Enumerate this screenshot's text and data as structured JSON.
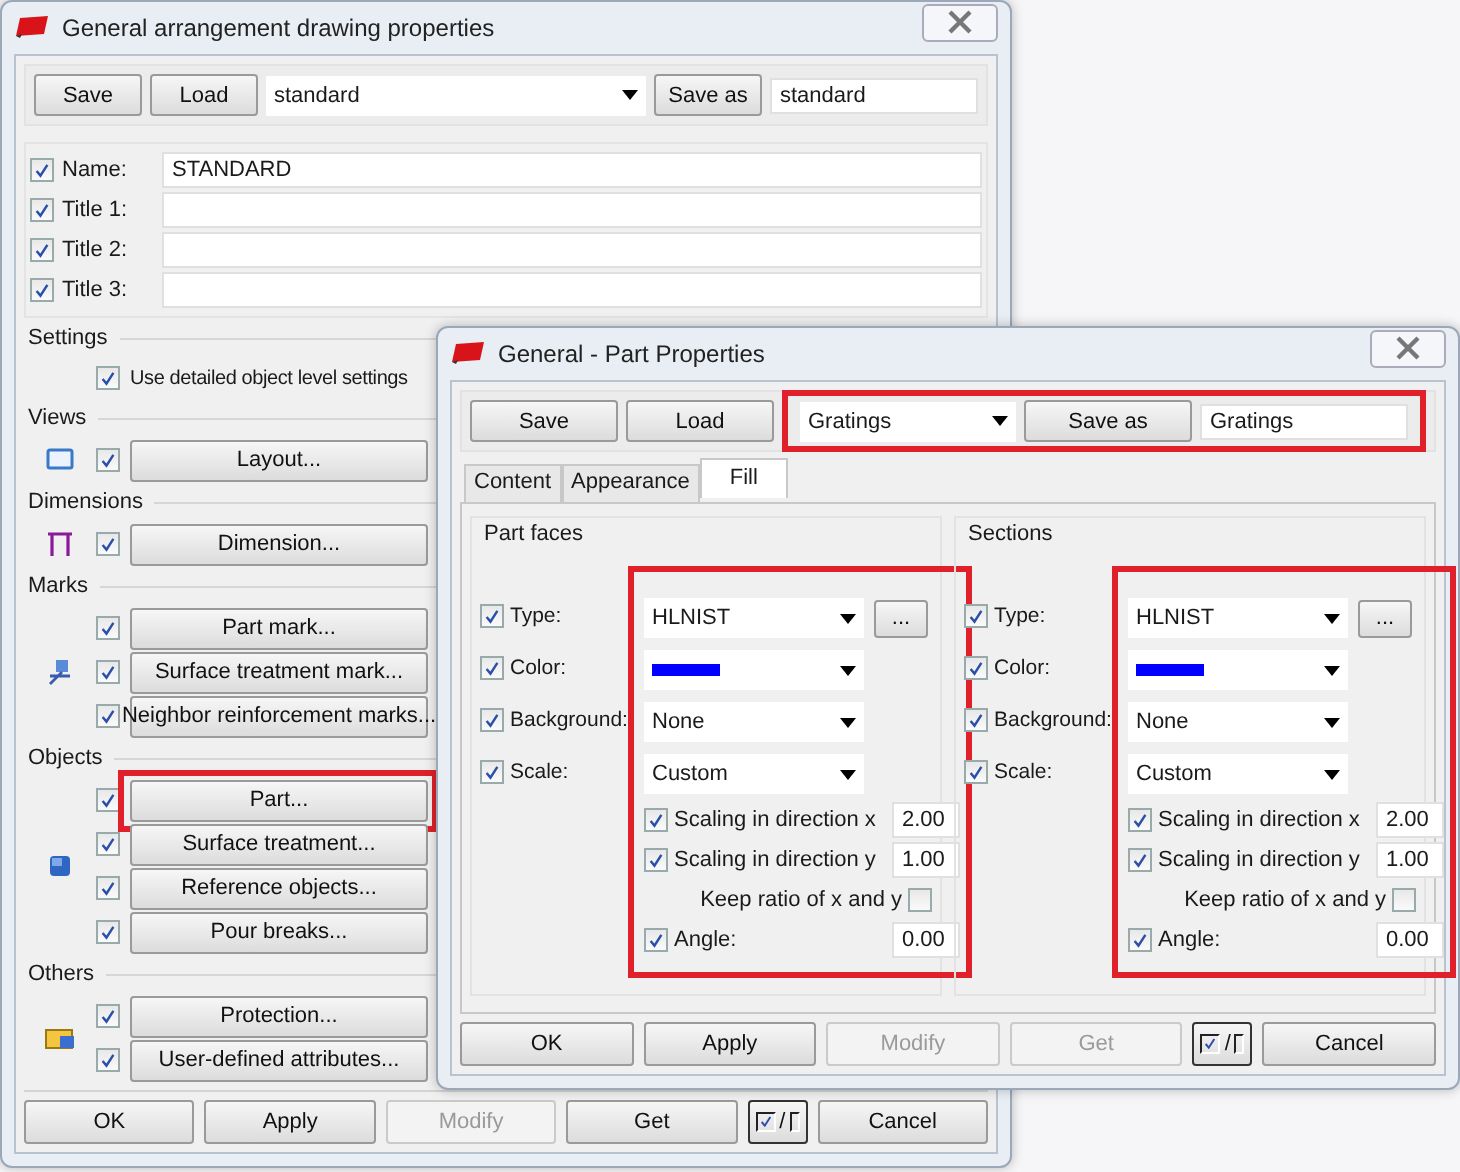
{
  "main_window": {
    "title": "General arrangement drawing properties",
    "file_bar": {
      "save": "Save",
      "load": "Load",
      "preset": "standard",
      "save_as": "Save as",
      "name": "standard"
    },
    "name_fields": [
      {
        "label": "Name:",
        "checked": true,
        "value": "STANDARD"
      },
      {
        "label": "Title 1:",
        "checked": true
      },
      {
        "label": "Title 2:",
        "checked": true
      },
      {
        "label": "Title 3:",
        "checked": true
      }
    ],
    "sections": [
      {
        "title": "Settings",
        "items": [
          {
            "kind": "checkbox",
            "label": "Use detailed object level settings",
            "checked": true
          }
        ]
      },
      {
        "title": "Views",
        "items": [
          {
            "kind": "button",
            "label": "Layout...",
            "checked": true,
            "highlighted": false
          }
        ]
      },
      {
        "title": "Dimensions",
        "items": [
          {
            "kind": "button",
            "label": "Dimension...",
            "checked": true,
            "highlighted": false
          }
        ]
      },
      {
        "title": "Marks",
        "items": [
          {
            "kind": "button",
            "label": "Part mark...",
            "checked": true,
            "highlighted": false
          },
          {
            "kind": "button",
            "label": "Surface treatment mark...",
            "checked": true,
            "highlighted": false
          },
          {
            "kind": "button",
            "label": "Neighbor reinforcement marks...",
            "checked": true,
            "highlighted": false
          }
        ]
      },
      {
        "title": "Objects",
        "items": [
          {
            "kind": "button",
            "label": "Part...",
            "checked": true,
            "highlighted": true
          },
          {
            "kind": "button",
            "label": "Surface treatment...",
            "checked": true,
            "highlighted": false
          },
          {
            "kind": "button",
            "label": "Reference objects...",
            "checked": true,
            "highlighted": false
          },
          {
            "kind": "button",
            "label": "Pour breaks...",
            "checked": true,
            "highlighted": false
          }
        ]
      },
      {
        "title": "Others",
        "items": [
          {
            "kind": "button",
            "label": "Protection...",
            "checked": true,
            "highlighted": false
          },
          {
            "kind": "button",
            "label": "User-defined attributes...",
            "checked": true,
            "highlighted": false
          }
        ]
      }
    ],
    "footer": [
      {
        "kind": "text",
        "label": "OK",
        "disabled": false
      },
      {
        "kind": "text",
        "label": "Apply",
        "disabled": false
      },
      {
        "kind": "text",
        "label": "Modify",
        "disabled": true
      },
      {
        "kind": "text",
        "label": "Get",
        "disabled": false
      },
      {
        "kind": "toggle",
        "label": "/",
        "disabled": false
      },
      {
        "kind": "text",
        "label": "Cancel",
        "disabled": false
      }
    ]
  },
  "part_window": {
    "title": "General - Part Properties",
    "file_bar": {
      "save": "Save",
      "load": "Load",
      "preset": "Gratings",
      "save_as": "Save as",
      "name": "Gratings",
      "highlighted": true
    },
    "tabs": [
      {
        "label": "Content",
        "selected": false
      },
      {
        "label": "Appearance",
        "selected": false
      },
      {
        "label": "Fill",
        "selected": true
      }
    ],
    "groups": [
      {
        "title": "Part faces",
        "highlighted": true,
        "rows": [
          {
            "kind": "select",
            "label": "Type:",
            "checked": true,
            "value": "HLNIST",
            "more": "..."
          },
          {
            "kind": "color",
            "label": "Color:",
            "checked": true,
            "color": "#0000ff"
          },
          {
            "kind": "select",
            "label": "Background:",
            "checked": true,
            "value": "None"
          },
          {
            "kind": "select",
            "label": "Scale:",
            "checked": true,
            "value": "Custom"
          }
        ],
        "options": [
          {
            "kind": "number",
            "label": "Scaling in direction x",
            "checked": true,
            "value": "2.00"
          },
          {
            "kind": "number",
            "label": "Scaling in direction y",
            "checked": true,
            "value": "1.00"
          },
          {
            "kind": "check_after",
            "label": "Keep ratio of x and y",
            "checked": false
          },
          {
            "kind": "number",
            "label": "Angle:",
            "checked": true,
            "value": "0.00"
          }
        ]
      },
      {
        "title": "Sections",
        "highlighted": true,
        "rows": [
          {
            "kind": "select",
            "label": "Type:",
            "checked": true,
            "value": "HLNIST",
            "more": "..."
          },
          {
            "kind": "color",
            "label": "Color:",
            "checked": true,
            "color": "#0000ff"
          },
          {
            "kind": "select",
            "label": "Background:",
            "checked": true,
            "value": "None"
          },
          {
            "kind": "select",
            "label": "Scale:",
            "checked": true,
            "value": "Custom"
          }
        ],
        "options": [
          {
            "kind": "number",
            "label": "Scaling in direction x",
            "checked": true,
            "value": "2.00"
          },
          {
            "kind": "number",
            "label": "Scaling in direction y",
            "checked": true,
            "value": "1.00"
          },
          {
            "kind": "check_after",
            "label": "Keep ratio of x and y",
            "checked": false
          },
          {
            "kind": "number",
            "label": "Angle:",
            "checked": true,
            "value": "0.00"
          }
        ]
      }
    ],
    "footer": [
      {
        "kind": "text",
        "label": "OK",
        "disabled": false
      },
      {
        "kind": "text",
        "label": "Apply",
        "disabled": false
      },
      {
        "kind": "text",
        "label": "Modify",
        "disabled": true
      },
      {
        "kind": "text",
        "label": "Get",
        "disabled": true
      },
      {
        "kind": "toggle",
        "label": "/",
        "disabled": false
      },
      {
        "kind": "text",
        "label": "Cancel",
        "disabled": false
      }
    ]
  }
}
